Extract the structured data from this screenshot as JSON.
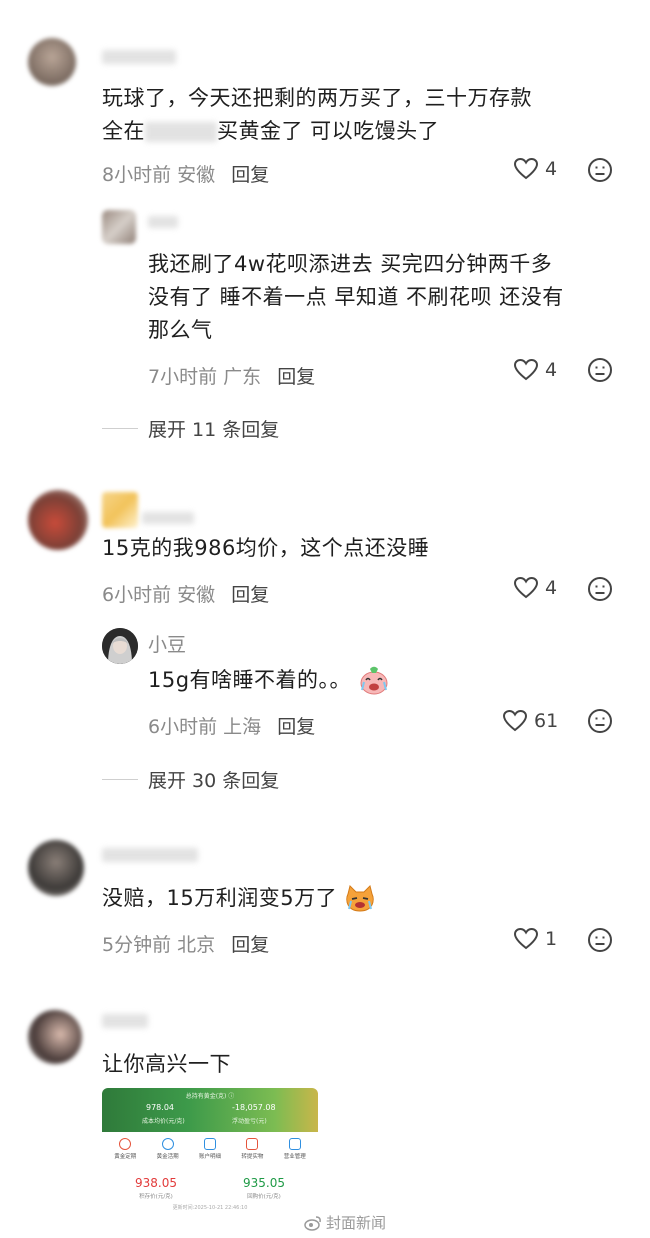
{
  "comments": [
    {
      "text_line1": "玩球了，今天还把剩的两万买了，三十万存款",
      "text_line2_a": "全在",
      "text_line2_b": "买黄金了  可以吃馒头了",
      "time": "8小时前",
      "location": "安徽",
      "reply_label": "回复",
      "likes": "4",
      "reply": {
        "text_line1": "我还刷了4w花呗添进去  买完四分钟两千多",
        "text_line2": "没有了  睡不着一点  早知道  不刷花呗  还没有",
        "text_line3": "那么气",
        "time": "7小时前",
        "location": "广东",
        "reply_label": "回复",
        "likes": "4"
      },
      "expand_label": "展开 11 条回复"
    },
    {
      "text": "15克的我986均价，这个点还没睡",
      "time": "6小时前",
      "location": "安徽",
      "reply_label": "回复",
      "likes": "4",
      "reply": {
        "username": "小豆",
        "text": "15g有啥睡不着的。。",
        "time": "6小时前",
        "location": "上海",
        "reply_label": "回复",
        "likes": "61"
      },
      "expand_label": "展开 30 条回复"
    },
    {
      "text": "没赔，15万利润变5万了",
      "time": "5分钟前",
      "location": "北京",
      "reply_label": "回复",
      "likes": "1"
    },
    {
      "text": "让你高兴一下",
      "screenshot": {
        "header": "总持有黄金(克) ⓘ",
        "avg_cost_value": "978.04",
        "avg_cost_label": "成本均价(元/克)",
        "float_pl_value": "-18,057.08",
        "float_pl_label": "浮动盈亏(元)",
        "tabs": [
          "黄金定期",
          "黄金活期",
          "账户明细",
          "转提实物",
          "营业管理"
        ],
        "deposit_price": "938.05",
        "deposit_label": "积存价(元/克)",
        "buyback_price": "935.05",
        "buyback_label": "回购价(元/克)",
        "updated": "更新时间:2025-10-21 22:46:10"
      }
    }
  ],
  "watermark": "封面新闻",
  "colors": {
    "text": "#1f1f1f",
    "meta": "#8a8a8a",
    "deposit_red": "#e23b3b",
    "buyback_green": "#1f9a46"
  }
}
